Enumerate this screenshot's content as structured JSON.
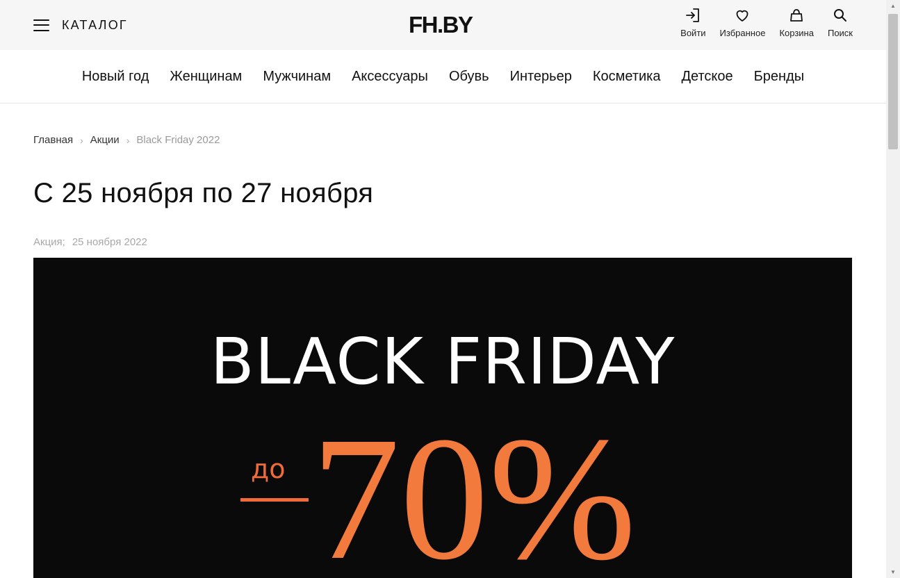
{
  "header": {
    "catalog_label": "КАТАЛОГ",
    "logo": "FH.BY",
    "actions": [
      {
        "label": "Войти",
        "icon": "login-icon"
      },
      {
        "label": "Избранное",
        "icon": "heart-icon"
      },
      {
        "label": "Корзина",
        "icon": "bag-icon"
      },
      {
        "label": "Поиск",
        "icon": "search-icon"
      }
    ]
  },
  "nav": {
    "items": [
      "Новый год",
      "Женщинам",
      "Мужчинам",
      "Аксессуары",
      "Обувь",
      "Интерьер",
      "Косметика",
      "Детское",
      "Бренды"
    ]
  },
  "breadcrumb": {
    "items": [
      "Главная",
      "Акции"
    ],
    "current": "Black Friday 2022"
  },
  "page": {
    "title": "С 25 ноября по 27 ноября",
    "meta_type": "Акция;",
    "meta_date": "25 ноября 2022"
  },
  "banner": {
    "headline": "BLACK FRIDAY",
    "prefix": "до",
    "discount": "70%",
    "background_color": "#0a0a0a",
    "accent_color": "#f06a3a"
  }
}
